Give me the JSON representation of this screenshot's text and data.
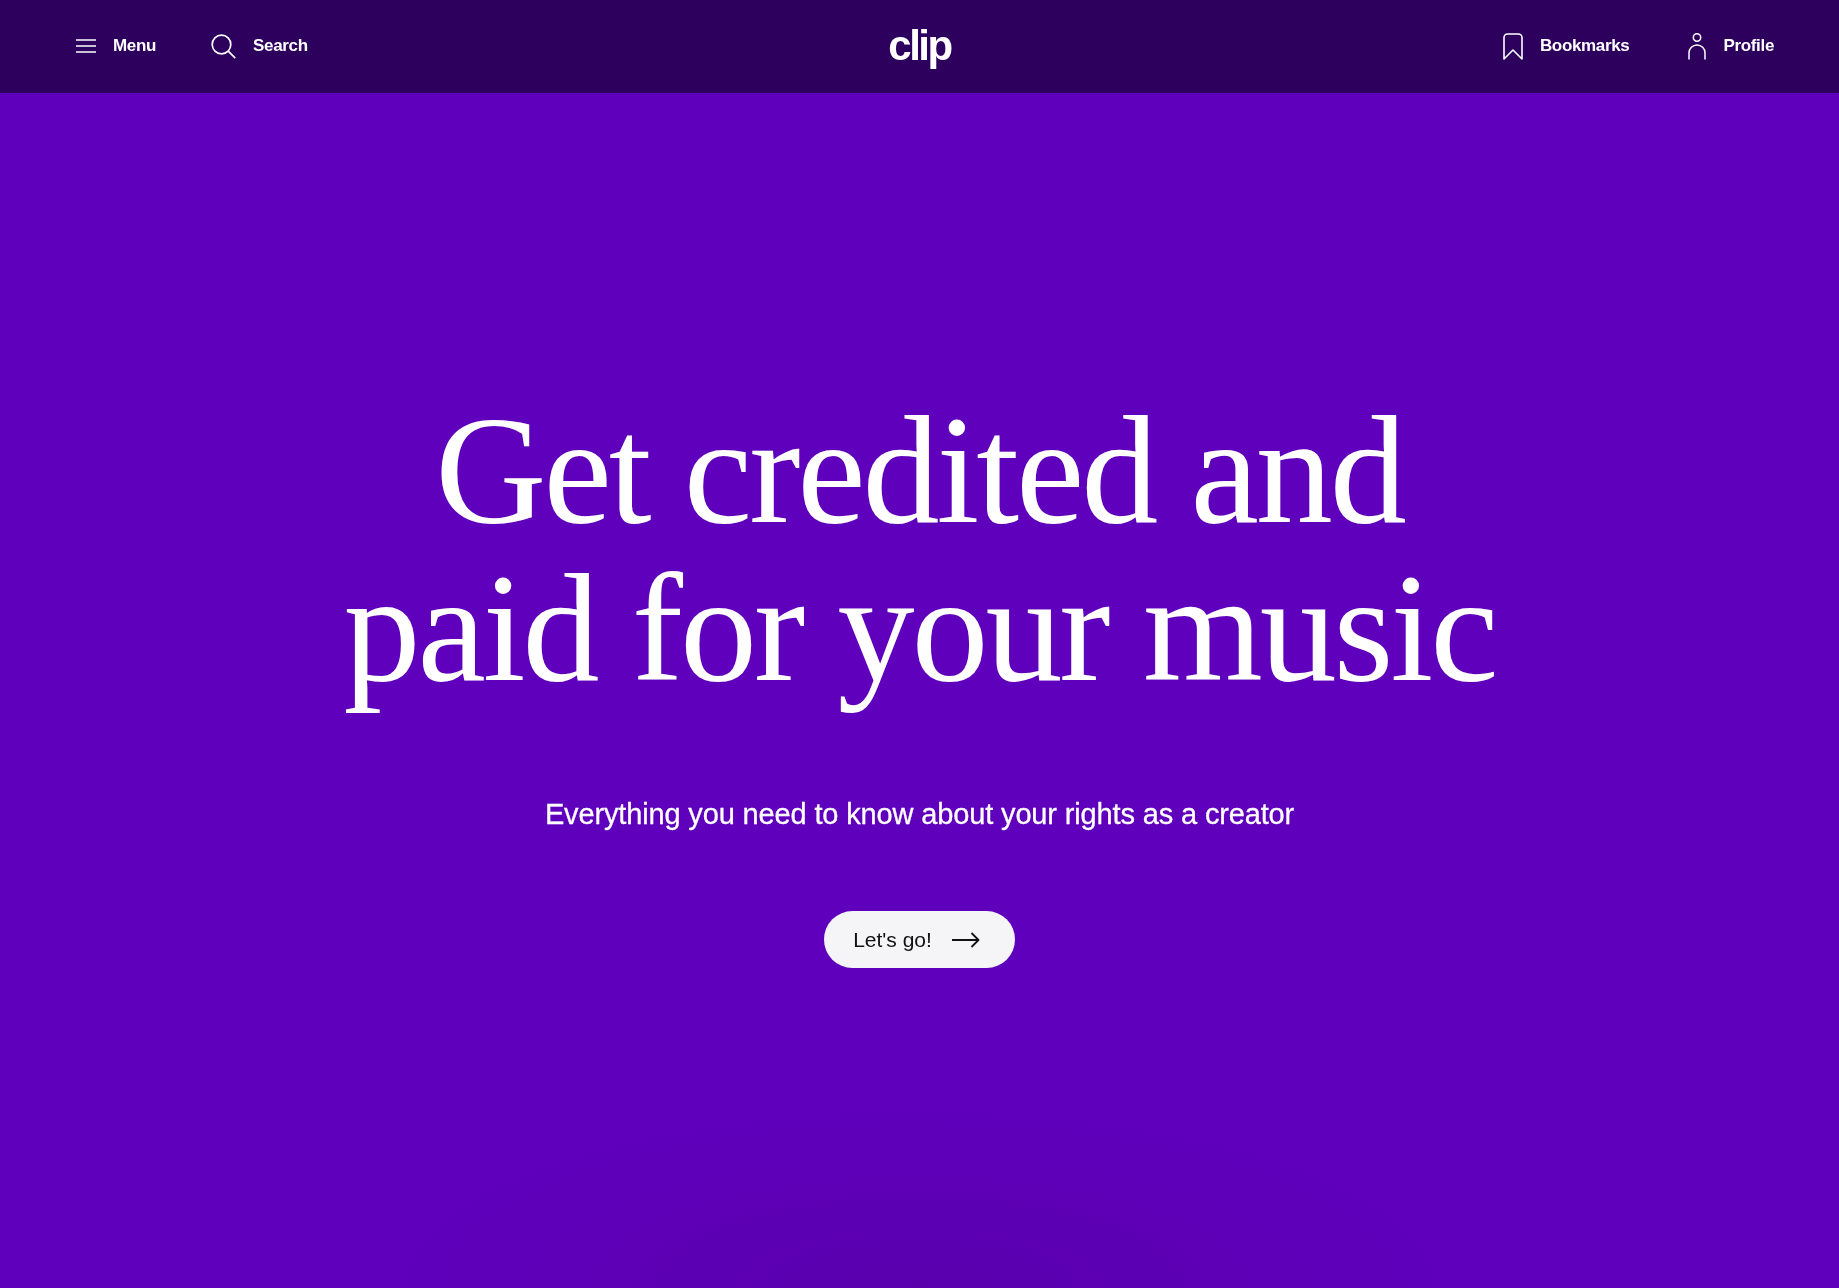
{
  "navbar": {
    "left_items": [
      {
        "kind": "menu",
        "label": "Menu"
      },
      {
        "kind": "search",
        "label": "Search"
      }
    ],
    "logo": "clip",
    "right_items": [
      {
        "kind": "bookmark",
        "label": "Bookmarks"
      },
      {
        "kind": "profile",
        "label": "Profile"
      }
    ]
  },
  "hero": {
    "headline": "Get credited and paid for your music",
    "subtitle": "Everything you need to know about your rights as a creator",
    "cta": {
      "label": "Let's go!"
    }
  }
}
